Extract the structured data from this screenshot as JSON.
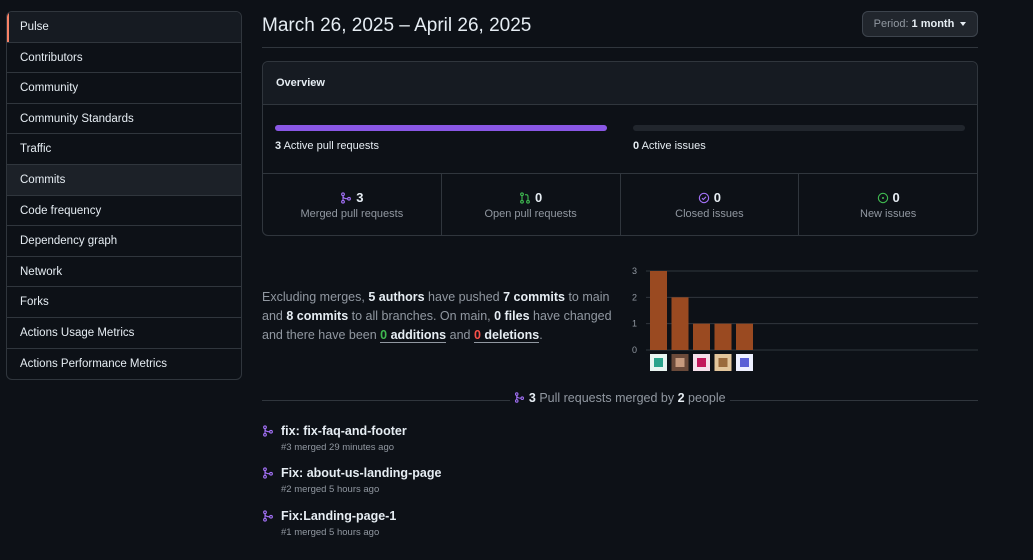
{
  "sidebar": {
    "items": [
      {
        "label": "Pulse",
        "name": "sidebar-item-pulse"
      },
      {
        "label": "Contributors",
        "name": "sidebar-item-contributors"
      },
      {
        "label": "Community",
        "name": "sidebar-item-community"
      },
      {
        "label": "Community Standards",
        "name": "sidebar-item-community-standards"
      },
      {
        "label": "Traffic",
        "name": "sidebar-item-traffic"
      },
      {
        "label": "Commits",
        "name": "sidebar-item-commits"
      },
      {
        "label": "Code frequency",
        "name": "sidebar-item-code-frequency"
      },
      {
        "label": "Dependency graph",
        "name": "sidebar-item-dependency-graph"
      },
      {
        "label": "Network",
        "name": "sidebar-item-network"
      },
      {
        "label": "Forks",
        "name": "sidebar-item-forks"
      },
      {
        "label": "Actions Usage Metrics",
        "name": "sidebar-item-actions-usage-metrics"
      },
      {
        "label": "Actions Performance Metrics",
        "name": "sidebar-item-actions-performance-metrics"
      }
    ],
    "selected": "Pulse",
    "hovered": "Commits"
  },
  "header": {
    "date_range": "March 26, 2025 – April 26, 2025",
    "period_label": "Period:",
    "period_value": "1 month"
  },
  "overview": {
    "title": "Overview",
    "active_prs_count": "3",
    "active_prs_label": "Active pull requests",
    "active_prs_fill": 1.0,
    "active_issues_count": "0",
    "active_issues_label": "Active issues",
    "active_issues_fill": 0,
    "stats": {
      "merged": {
        "count": "3",
        "label": "Merged pull requests"
      },
      "open": {
        "count": "0",
        "label": "Open pull requests"
      },
      "closed": {
        "count": "0",
        "label": "Closed issues"
      },
      "new": {
        "count": "0",
        "label": "New issues"
      }
    }
  },
  "summary": {
    "t1": "Excluding merges, ",
    "authors": "5 authors",
    "t2": " have pushed ",
    "commits_main": "7 commits",
    "t3": " to main and ",
    "commits_all": "8 commits",
    "t4": " to all branches. On main, ",
    "files": "0 files",
    "t5": " have changed and there have been ",
    "additions_n": "0",
    "additions_w": " additions",
    "t6": " and ",
    "deletions_n": "0",
    "deletions_w": " deletions",
    "t7": "."
  },
  "chart_data": {
    "type": "bar",
    "categories": [
      "author-1",
      "author-2",
      "author-3",
      "author-4",
      "author-5"
    ],
    "values": [
      3,
      2,
      1,
      1,
      1
    ],
    "yticks": [
      "0",
      "1",
      "2",
      "3"
    ],
    "ylim": [
      0,
      3
    ],
    "bar_color": "#9a4a21",
    "grid": true
  },
  "pr_section": {
    "count": "3",
    "t1": " Pull requests merged by ",
    "people": "2",
    "t2": " people"
  },
  "pull_requests": [
    {
      "title": "fix: fix-faq-and-footer",
      "meta": "#3 merged 29 minutes ago"
    },
    {
      "title": "Fix: about-us-landing-page",
      "meta": "#2 merged 5 hours ago"
    },
    {
      "title": "Fix:Landing-page-1",
      "meta": "#1 merged 5 hours ago"
    }
  ],
  "colors": {
    "background": "#0d1117",
    "border": "#30363d",
    "accent_purple": "#8957e5",
    "selected_marker": "#f78166",
    "green": "#3fb950",
    "red": "#f85149",
    "bar": "#9a4a21"
  }
}
